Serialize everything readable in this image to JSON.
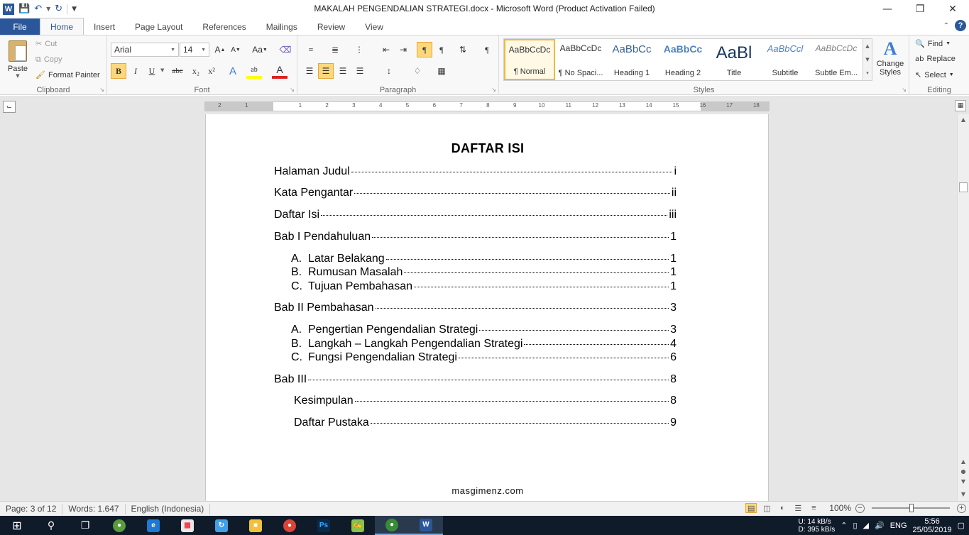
{
  "window": {
    "title": "MAKALAH PENGENDALIAN STRATEGI.docx  -  Microsoft Word (Product Activation Failed)",
    "app_icon": "W"
  },
  "tabs": [
    "Home",
    "Insert",
    "Page Layout",
    "References",
    "Mailings",
    "Review",
    "View"
  ],
  "file_tab": "File",
  "clipboard": {
    "paste": "Paste",
    "cut": "Cut",
    "copy": "Copy",
    "format_painter": "Format Painter",
    "label": "Clipboard"
  },
  "font": {
    "family": "Arial",
    "size": "14",
    "label": "Font",
    "bold": "B",
    "italic": "I",
    "underline": "U",
    "strike": "abc",
    "subscript": "x₂",
    "superscript": "x²"
  },
  "paragraph": {
    "label": "Paragraph"
  },
  "styles": {
    "label": "Styles",
    "items": [
      {
        "sample": "AaBbCcDc",
        "name": "¶ Normal"
      },
      {
        "sample": "AaBbCcDc",
        "name": "¶ No Spaci..."
      },
      {
        "sample": "AaBbCc",
        "name": "Heading 1"
      },
      {
        "sample": "AaBbCc",
        "name": "Heading 2"
      },
      {
        "sample": "AaBl",
        "name": "Title"
      },
      {
        "sample": "AaBbCcl",
        "name": "Subtitle"
      },
      {
        "sample": "AaBbCcDc",
        "name": "Subtle Em..."
      }
    ],
    "change_styles": "Change Styles"
  },
  "editing": {
    "label": "Editing",
    "find": "Find",
    "replace": "Replace",
    "select": "Select"
  },
  "ruler": {
    "numbers": [
      "2",
      "1",
      "1",
      "2",
      "3",
      "4",
      "5",
      "6",
      "7",
      "8",
      "9",
      "10",
      "11",
      "12",
      "13",
      "14",
      "15",
      "16",
      "17",
      "18"
    ]
  },
  "document": {
    "title": "DAFTAR ISI",
    "toc": [
      {
        "marker": "",
        "label": "Halaman Judul",
        "page": "i"
      },
      {
        "marker": "",
        "label": "Kata Pengantar",
        "page": "ii"
      },
      {
        "marker": "",
        "label": "Daftar Isi ",
        "page": "iii"
      },
      {
        "marker": "",
        "label": "Bab I Pendahuluan ",
        "page": "1"
      },
      {
        "marker": "A.",
        "label": "Latar Belakang ",
        "page": "1"
      },
      {
        "marker": "B.",
        "label": "Rumusan Masalah",
        "page": "1"
      },
      {
        "marker": "C.",
        "label": "Tujuan Pembahasan ",
        "page": "1"
      },
      {
        "marker": "",
        "label": "Bab II Pembahasan",
        "page": "3"
      },
      {
        "marker": "A.",
        "label": "Pengertian Pengendalian Strategi",
        "page": "3"
      },
      {
        "marker": "B.",
        "label": "Langkah – Langkah Pengendalian Strategi",
        "page": "4"
      },
      {
        "marker": "C.",
        "label": "Fungsi Pengendalian Strategi",
        "page": "6"
      },
      {
        "marker": "",
        "label": "Bab III",
        "page": "8"
      },
      {
        "marker": "",
        "label": "Kesimpulan ",
        "page": "8"
      },
      {
        "marker": "",
        "label": "Daftar Pustaka",
        "page": "9"
      }
    ],
    "watermark": "masgimenz.com"
  },
  "status": {
    "page": "Page: 3 of 12",
    "words": "Words: 1.647",
    "language": "English (Indonesia)",
    "zoom": "100%"
  },
  "taskbar": {
    "net_up": "U:",
    "net_speed": "14 kB/s",
    "net_down": "D:",
    "net_speed2": "395 kB/s",
    "lang": "ENG",
    "time": "5:56",
    "date": "25/05/2019"
  },
  "colors": {
    "accent": "#2b579a",
    "highlight": "#fcd87c"
  }
}
